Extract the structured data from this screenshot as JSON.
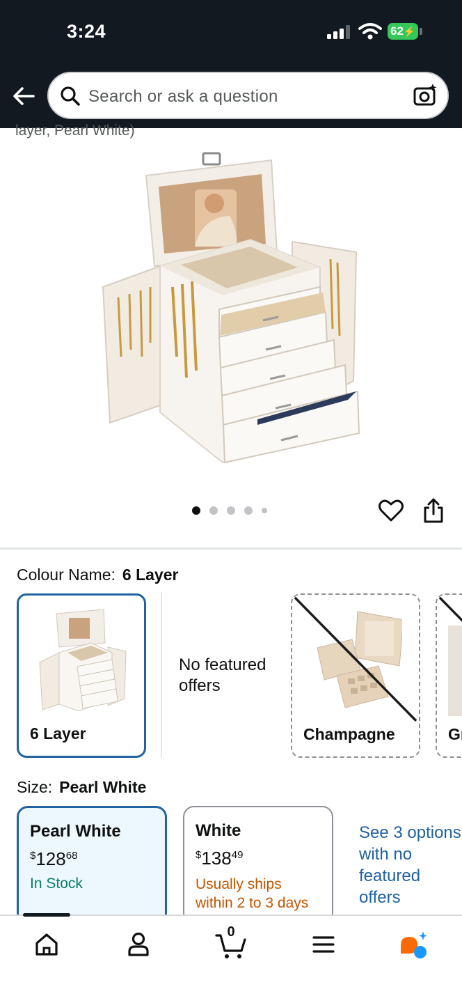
{
  "status_bar": {
    "time": "3:24",
    "battery": "62"
  },
  "header": {
    "search_placeholder": "Search or ask a question",
    "back_icon": "arrow-left-icon",
    "search_icon": "search-icon",
    "camera_icon": "camera-search-icon"
  },
  "product": {
    "title_fragment": "layer, Pearl White)",
    "image_count": 5,
    "active_image_index": 0
  },
  "colour": {
    "label": "Colour Name:",
    "selected_value": "6 Layer",
    "options": [
      {
        "name": "6 Layer",
        "state": "selected"
      },
      {
        "name": "Champagne",
        "state": "unavailable"
      },
      {
        "name": "Gr",
        "state": "unavailable"
      }
    ],
    "no_featured_offers": "No featured offers"
  },
  "size": {
    "label": "Size:",
    "selected_value": "Pearl White",
    "options": [
      {
        "name": "Pearl White",
        "currency": "$",
        "price_whole": "128",
        "price_fraction": "68",
        "availability": "In Stock"
      },
      {
        "name": "White",
        "currency": "$",
        "price_whole": "138",
        "price_fraction": "49",
        "availability": "Usually ships within 2 to 3 days"
      }
    ],
    "see_more": "See 3 options with no featured offers"
  },
  "bottom_nav": {
    "items": [
      "home-icon",
      "account-icon",
      "cart-icon",
      "menu-icon",
      "rufus-ai-icon"
    ],
    "cart_count": "0"
  },
  "colors": {
    "header_bg": "#131921",
    "selected_border": "#2162a1",
    "selected_bg": "#edf7fe",
    "in_stock": "#067d62",
    "ships_later": "#c45500",
    "link": "#2162a1",
    "battery": "#34c759"
  }
}
